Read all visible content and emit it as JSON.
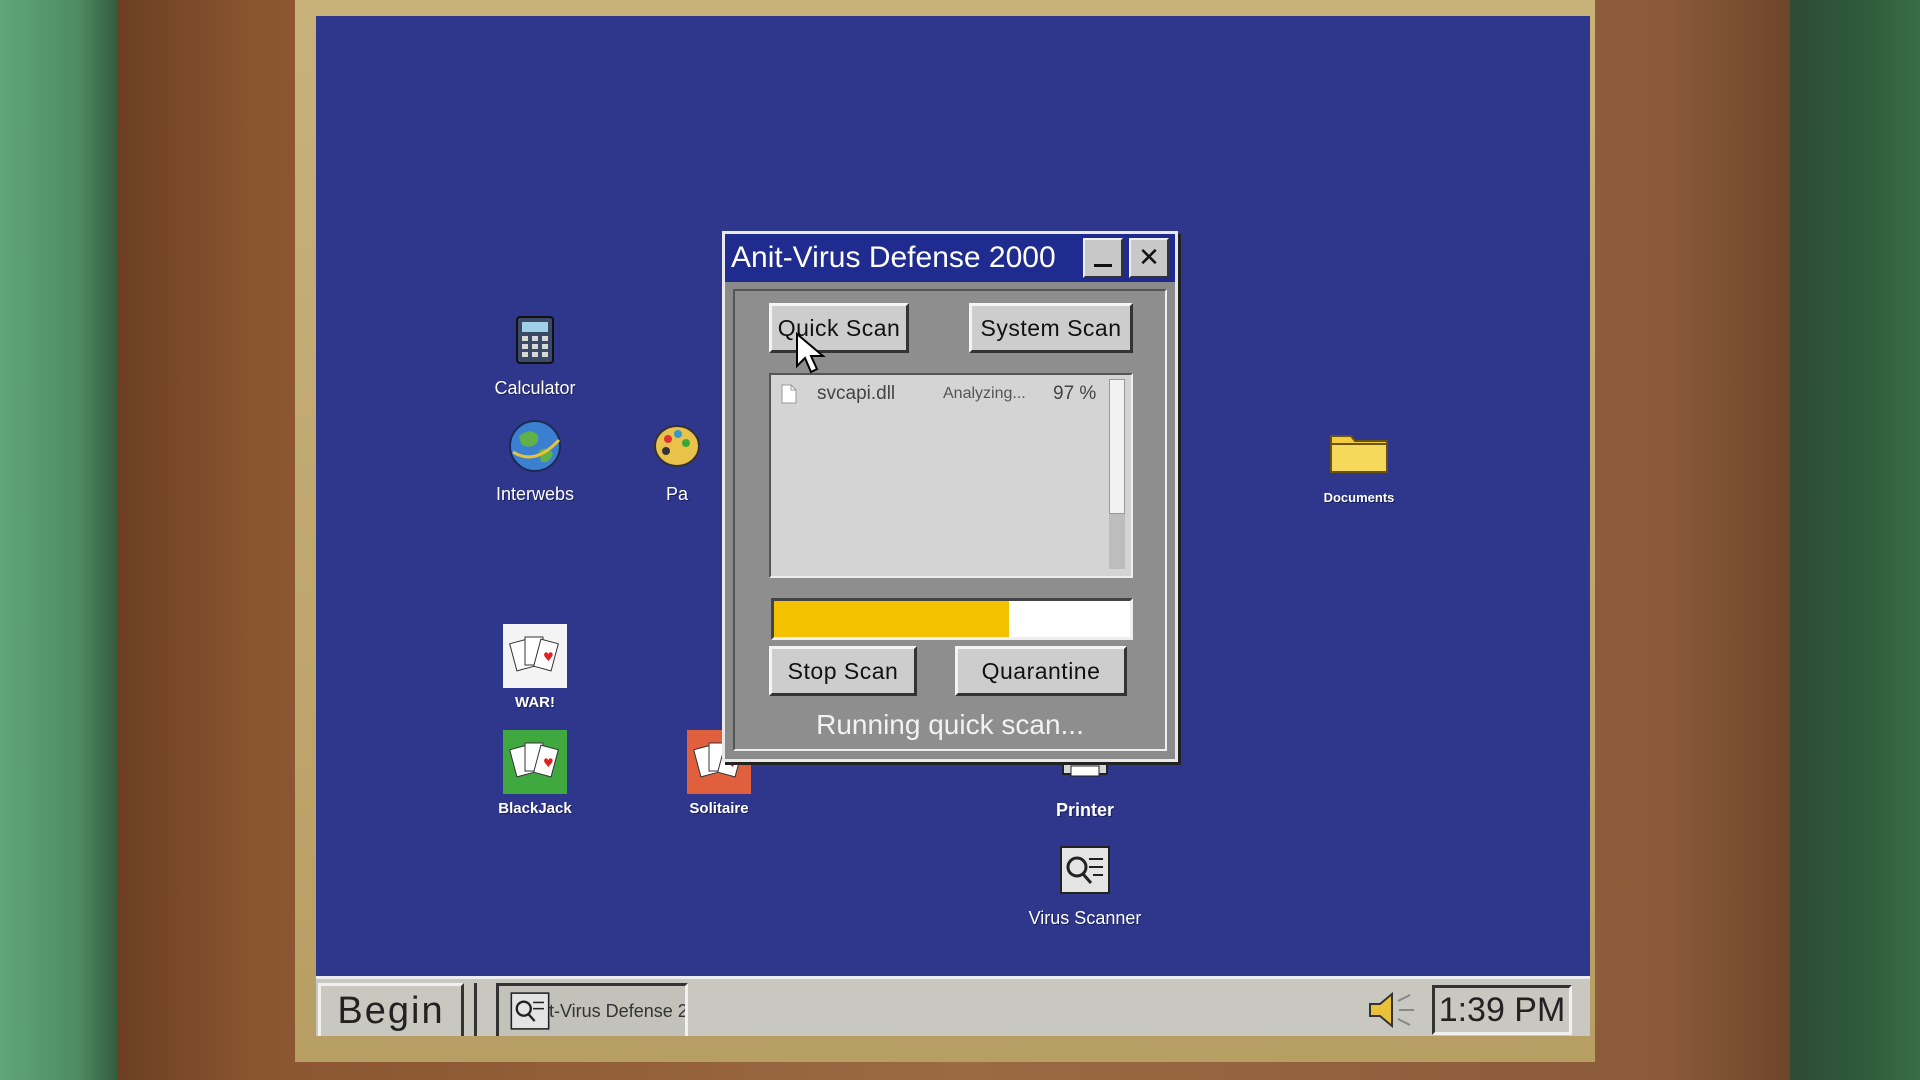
{
  "desktop": {
    "icons": [
      {
        "label": "Calculator",
        "icon": "calculator-icon"
      },
      {
        "label": "Interwebs",
        "icon": "globe-icon"
      },
      {
        "label": "Pa",
        "icon": "paint-palette-icon"
      },
      {
        "label": "WAR!",
        "icon": "cards-icon"
      },
      {
        "label": "BlackJack",
        "icon": "cards-green-icon"
      },
      {
        "label": "Solitaire",
        "icon": "cards-red-icon"
      },
      {
        "label": "Printer",
        "icon": "printer-icon"
      },
      {
        "label": "Virus Scanner",
        "icon": "virus-scanner-icon"
      },
      {
        "label": "Documents",
        "icon": "folder-icon"
      }
    ]
  },
  "window": {
    "title": "Anit-Virus Defense 2000",
    "minimize_label": "_",
    "close_label": "✕",
    "quick_scan_label": "Quick Scan",
    "system_scan_label": "System Scan",
    "scan_list": [
      {
        "file": "svcapi.dll",
        "status": "Analyzing...",
        "percent": "97 %"
      }
    ],
    "progress_fraction": 0.66,
    "stop_scan_label": "Stop Scan",
    "quarantine_label": "Quarantine",
    "status_text": "Running quick scan..."
  },
  "taskbar": {
    "begin_label": "Begin",
    "task_label": "t-Virus Defense 2",
    "clock": "1:39 PM"
  },
  "colors": {
    "desktop": "#2e378c",
    "titlebar": "#1f2b8e",
    "progress_fill": "#f2c200"
  }
}
